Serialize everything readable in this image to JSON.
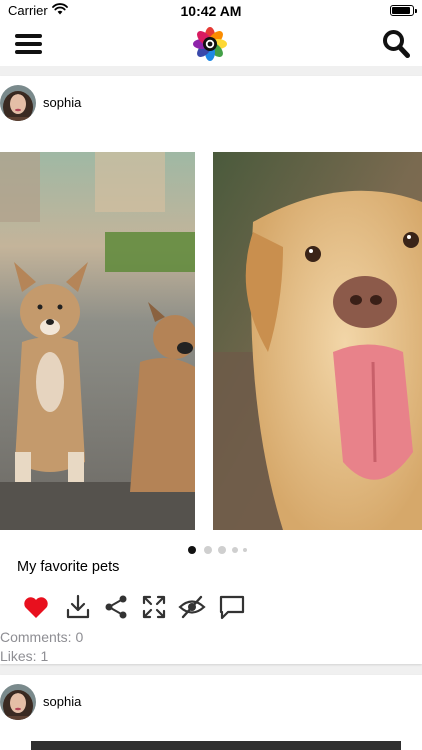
{
  "status_bar": {
    "carrier": "Carrier",
    "time": "10:42 AM",
    "icons": [
      "wifi-icon",
      "battery-icon"
    ]
  },
  "nav": {
    "icons": [
      "menu-icon",
      "app-logo",
      "search-icon"
    ]
  },
  "posts": [
    {
      "author": "sophia",
      "images": [
        "two-puppies-photo",
        "golden-retriever-photo"
      ],
      "carousel_pages": 5,
      "carousel_active": 0,
      "caption": "My favorite pets",
      "actions": [
        "heart-icon",
        "download-icon",
        "share-icon",
        "expand-icon",
        "hide-icon",
        "comment-icon"
      ],
      "liked": true,
      "comments": "Comments: 0",
      "likes": "Likes: 1"
    },
    {
      "author": "sophia"
    }
  ],
  "colors": {
    "like": "#e8101e",
    "icon": "#333333",
    "meta_text": "#8e8e93",
    "dot_active": "#111111",
    "dot_inactive": "#cfcfcf"
  }
}
